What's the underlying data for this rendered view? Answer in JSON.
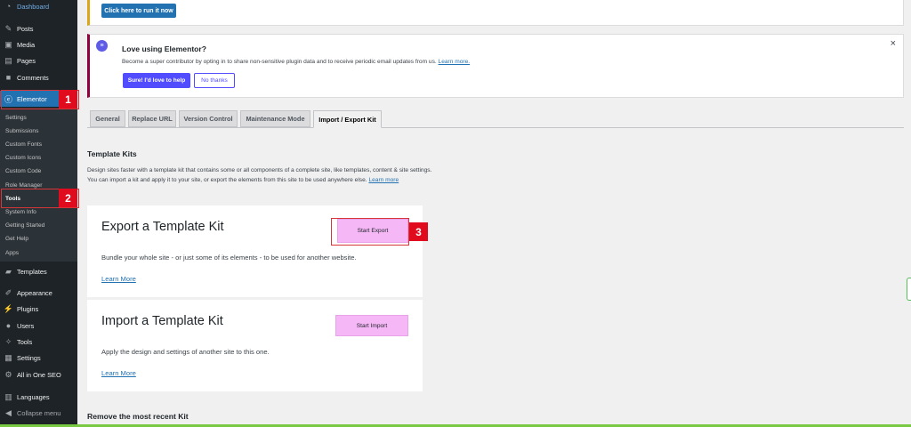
{
  "sidebar": {
    "items": [
      {
        "label": "Dashboard",
        "icon": "dashboard-icon"
      },
      {
        "label": "Posts",
        "icon": "pin-icon"
      },
      {
        "label": "Media",
        "icon": "media-icon"
      },
      {
        "label": "Pages",
        "icon": "page-icon"
      },
      {
        "label": "Comments",
        "icon": "comment-icon"
      },
      {
        "label": "Elementor",
        "icon": "elementor-icon"
      },
      {
        "label": "Templates",
        "icon": "folder-icon"
      },
      {
        "label": "Appearance",
        "icon": "brush-icon"
      },
      {
        "label": "Plugins",
        "icon": "plugin-icon"
      },
      {
        "label": "Users",
        "icon": "user-icon"
      },
      {
        "label": "Tools",
        "icon": "wrench-icon"
      },
      {
        "label": "Settings",
        "icon": "settings-icon"
      },
      {
        "label": "All in One SEO",
        "icon": "seo-icon"
      },
      {
        "label": "Languages",
        "icon": "languages-icon"
      },
      {
        "label": "Collapse menu",
        "icon": "collapse-icon"
      }
    ],
    "submenu": [
      "Settings",
      "Submissions",
      "Custom Fonts",
      "Custom Icons",
      "Custom Code",
      "Role Manager",
      "Tools",
      "System Info",
      "Getting Started",
      "Get Help",
      "Apps"
    ]
  },
  "markers": [
    "1",
    "2",
    "3"
  ],
  "top_notice": {
    "button": "Click here to run it now"
  },
  "elementor_notice": {
    "title": "Love using Elementor?",
    "text": "Become a super contributor by opting in to share non-sensitive plugin data and to receive periodic email updates from us.",
    "link": "Learn more.",
    "accept": "Sure! I'd love to help",
    "decline": "No thanks",
    "close": "×"
  },
  "tabs": [
    "General",
    "Replace URL",
    "Version Control",
    "Maintenance Mode",
    "Import / Export Kit"
  ],
  "kits": {
    "heading": "Template Kits",
    "desc1": "Design sites faster with a template kit that contains some or all components of a complete site, like templates, content & site settings.",
    "desc2": "You can import a kit and apply it to your site, or export the elements from this site to be used anywhere else.",
    "desc_link": "Learn more"
  },
  "export_card": {
    "title": "Export a Template Kit",
    "button": "Start Export",
    "desc": "Bundle your whole site - or just some of its elements - to be used for another website.",
    "link": "Learn More"
  },
  "import_card": {
    "title": "Import a Template Kit",
    "button": "Start Import",
    "desc": "Apply the design and settings of another site to this one.",
    "link": "Learn More"
  },
  "remove_heading": "Remove the most recent Kit"
}
